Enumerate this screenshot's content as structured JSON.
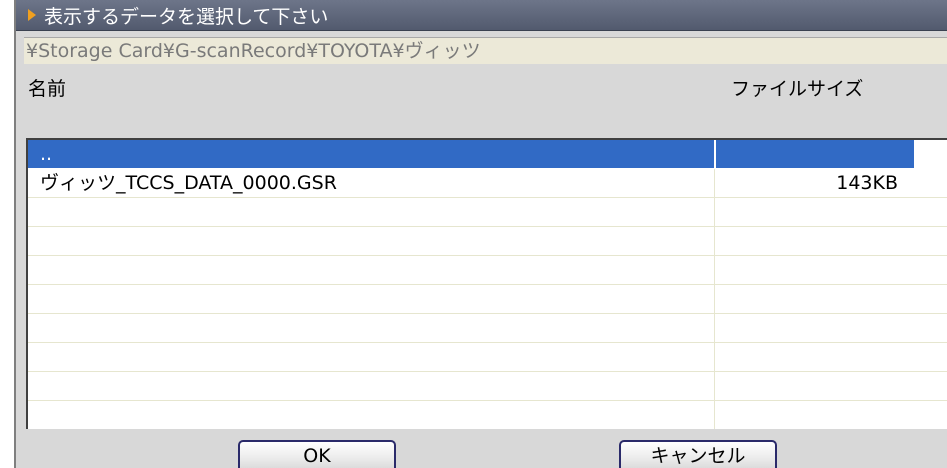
{
  "dialog": {
    "title": "表示するデータを選択して下さい",
    "path": "¥Storage Card¥G-scanRecord¥TOYOTA¥ヴィッツ"
  },
  "columns": {
    "name": "名前",
    "size": "ファイルサイズ"
  },
  "rows": [
    {
      "name": "..",
      "size": "",
      "selected": true
    },
    {
      "name": "ヴィッツ_TCCS_DATA_0000.GSR",
      "size": "143KB",
      "selected": false
    },
    {
      "name": "",
      "size": "",
      "selected": false
    },
    {
      "name": "",
      "size": "",
      "selected": false
    },
    {
      "name": "",
      "size": "",
      "selected": false
    },
    {
      "name": "",
      "size": "",
      "selected": false
    },
    {
      "name": "",
      "size": "",
      "selected": false
    },
    {
      "name": "",
      "size": "",
      "selected": false
    },
    {
      "name": "",
      "size": "",
      "selected": false
    },
    {
      "name": "",
      "size": "",
      "selected": false
    }
  ],
  "buttons": {
    "ok": "OK",
    "cancel": "キャンセル"
  },
  "colors": {
    "title_bar": "#5e6679",
    "selection": "#316ac5",
    "title_arrow": "#f0a020"
  },
  "icons": {
    "title_marker": "play-arrow-icon"
  }
}
